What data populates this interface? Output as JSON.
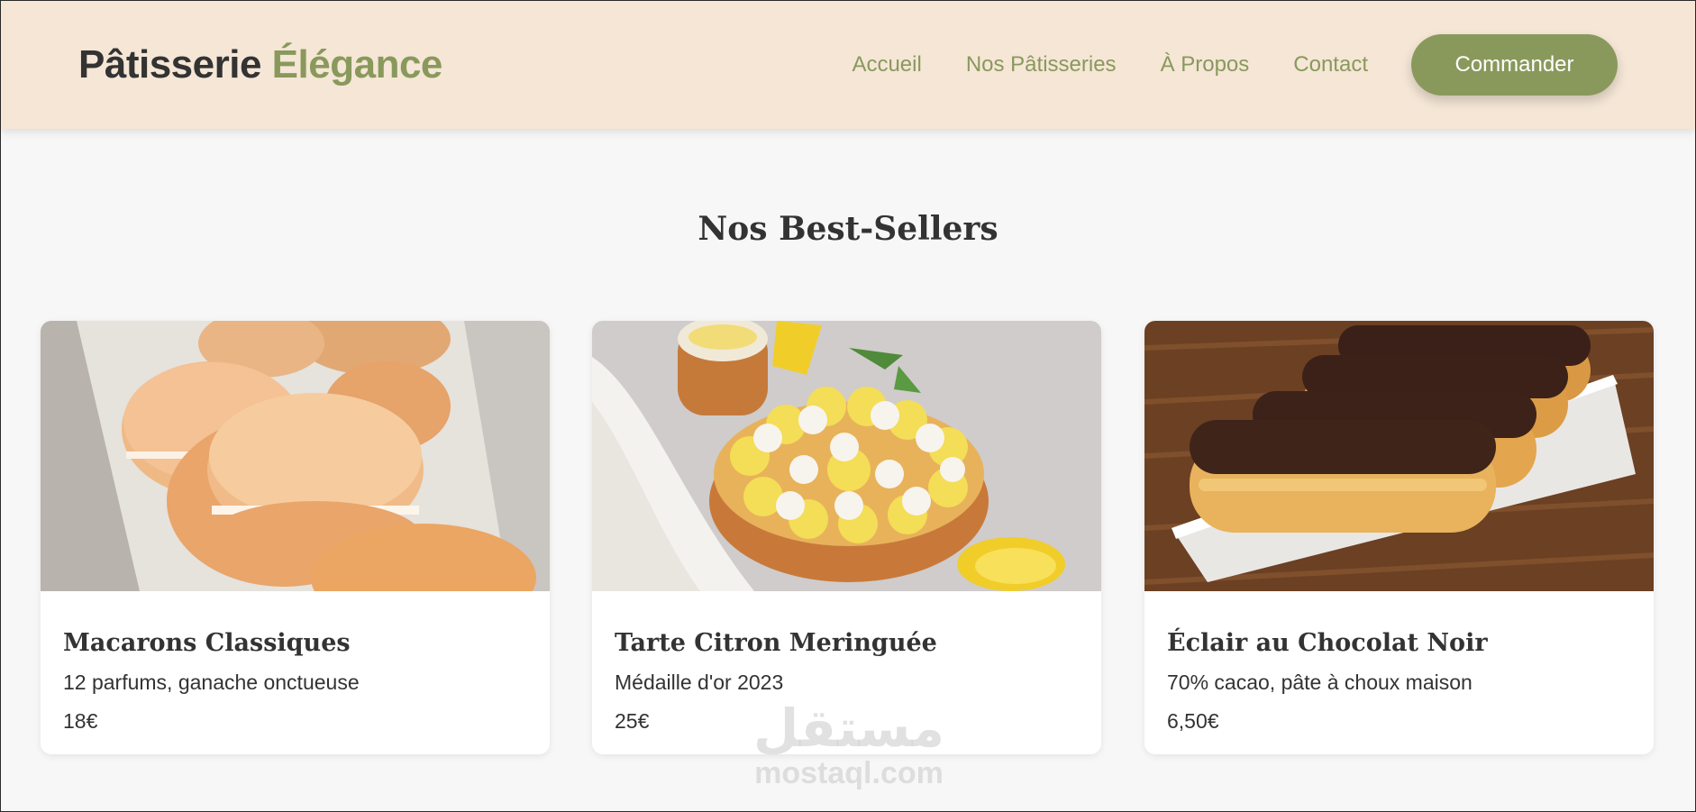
{
  "header": {
    "brand_main": "Pâtisserie",
    "brand_accent": "Élégance",
    "nav": [
      "Accueil",
      "Nos Pâtisseries",
      "À Propos",
      "Contact"
    ],
    "cta_label": "Commander"
  },
  "colors": {
    "header_bg": "#f5e6d6",
    "accent": "#89995c",
    "page_bg": "#f7f7f7",
    "text": "#333333"
  },
  "section": {
    "title": "Nos Best-Sellers"
  },
  "products": [
    {
      "name": "Macarons Classiques",
      "description": "12 parfums, ganache onctueuse",
      "price": "18€",
      "image": "macarons-image"
    },
    {
      "name": "Tarte Citron Meringuée",
      "description": "Médaille d'or 2023",
      "price": "25€",
      "image": "lemon-tart-image"
    },
    {
      "name": "Éclair au Chocolat Noir",
      "description": "70% cacao, pâte à choux maison",
      "price": "6,50€",
      "image": "eclair-image"
    }
  ],
  "watermark": {
    "arabic": "مستقل",
    "latin": "mostaql.com"
  }
}
